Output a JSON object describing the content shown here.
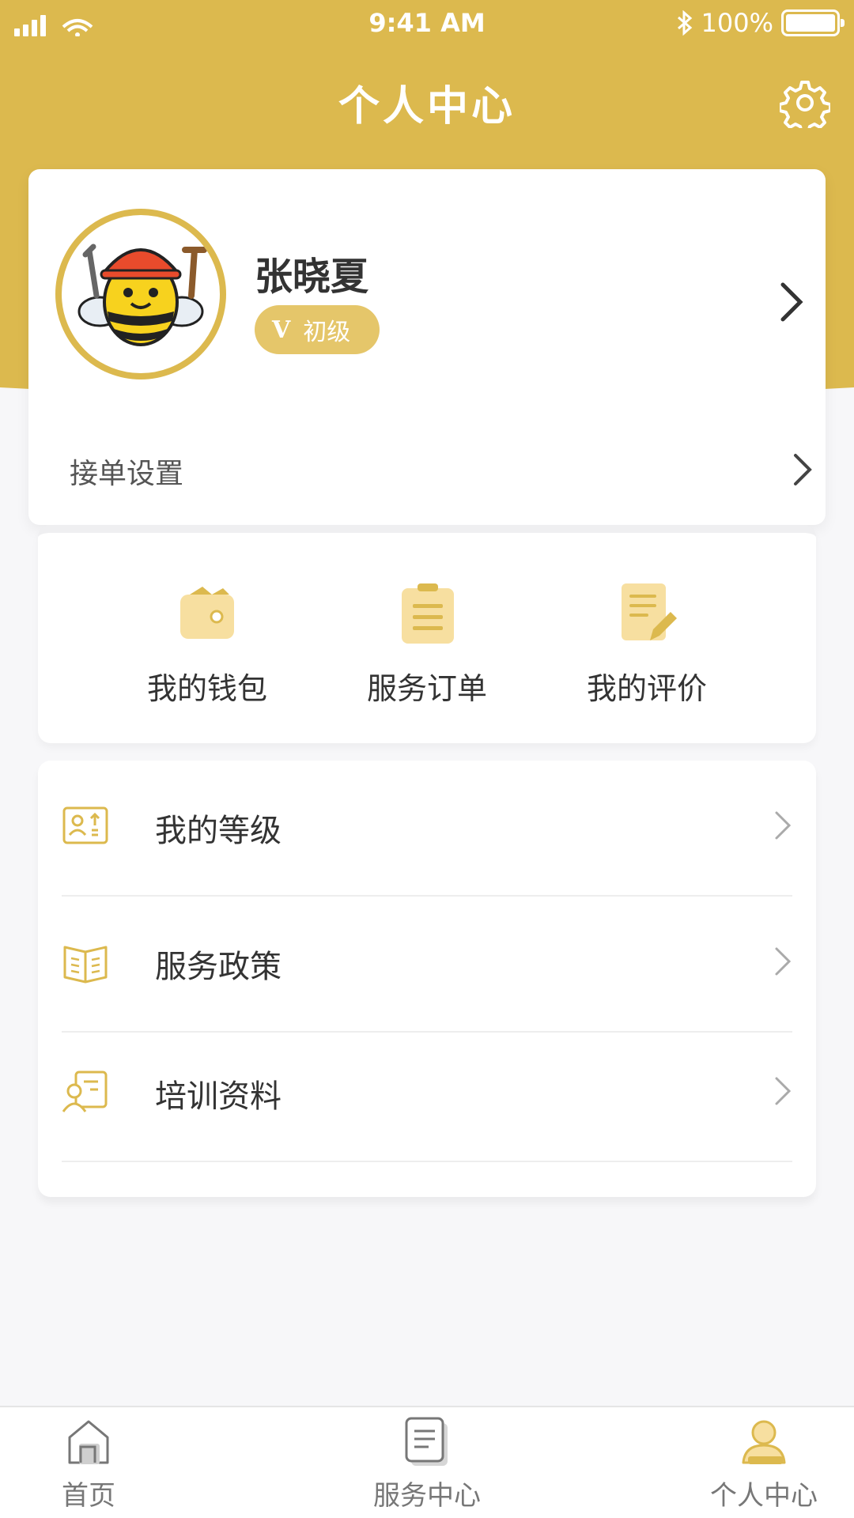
{
  "status_bar": {
    "time": "9:41 AM",
    "battery": "100%"
  },
  "header": {
    "title": "个人中心"
  },
  "profile": {
    "name": "张晓夏",
    "level_mark": "V",
    "level": "初级"
  },
  "order_setting": {
    "label": "接单设置"
  },
  "quick_actions": [
    {
      "label": "我的钱包",
      "icon": "wallet-icon"
    },
    {
      "label": "服务订单",
      "icon": "clipboard-icon"
    },
    {
      "label": "我的评价",
      "icon": "review-edit-icon"
    }
  ],
  "menu": [
    {
      "label": "我的等级",
      "icon": "level-card-icon"
    },
    {
      "label": "服务政策",
      "icon": "policy-book-icon"
    },
    {
      "label": "培训资料",
      "icon": "training-icon"
    }
  ],
  "tabbar": [
    {
      "label": "首页",
      "icon": "home-icon"
    },
    {
      "label": "服务中心",
      "icon": "document-icon"
    },
    {
      "label": "个人中心",
      "icon": "user-icon",
      "active": true
    }
  ],
  "colors": {
    "accent": "#dcb94e",
    "accent_light": "#f7dfa0",
    "background": "#f7f7f9"
  }
}
